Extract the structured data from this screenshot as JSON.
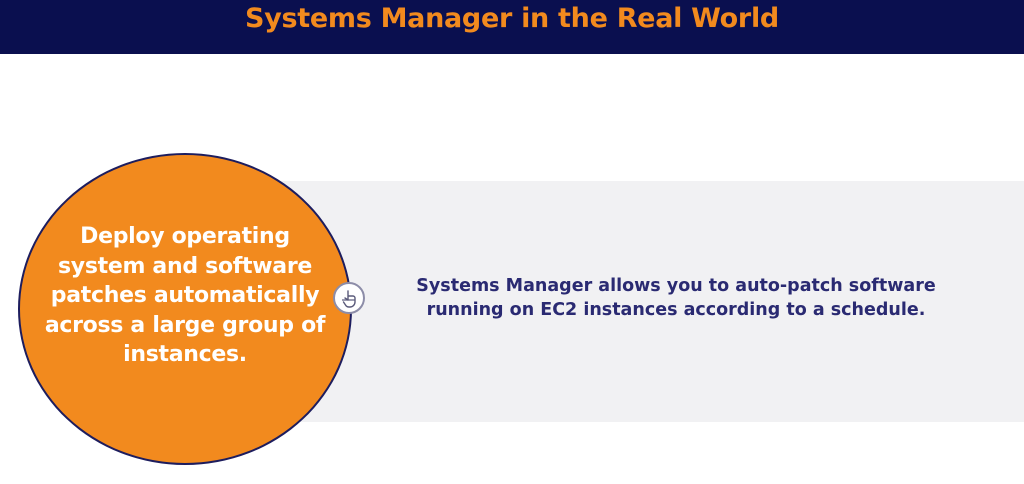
{
  "header": {
    "title": "Systems Manager in the Real World"
  },
  "circle": {
    "text": "Deploy operating system and software patches automatically across a large group of instances."
  },
  "connector": {
    "icon": "hand-pointer-icon"
  },
  "panel": {
    "text": "Systems Manager allows you to auto-patch software running on EC2 instances according to a schedule."
  },
  "colors": {
    "header_bg": "#0a0f4f",
    "title": "#f28a1e",
    "circle_fill": "#f28a1e",
    "panel_bg": "#f1f1f3",
    "body_text": "#2a2a72"
  }
}
